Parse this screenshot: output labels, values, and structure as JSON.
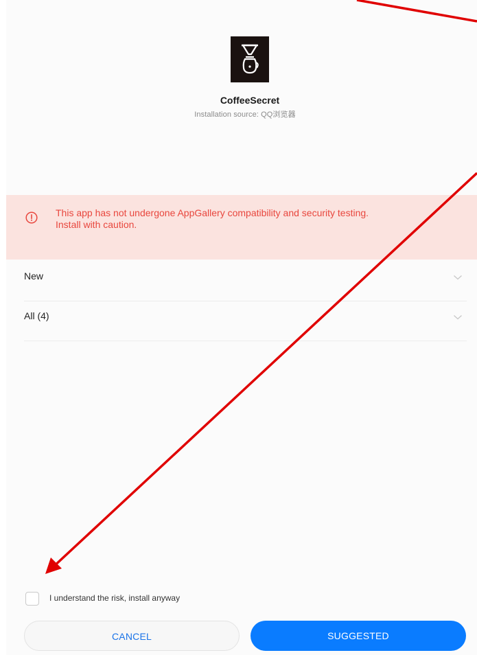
{
  "app": {
    "name": "CoffeeSecret",
    "install_source": "Installation source: QQ浏览器",
    "icon": "coffee-pour-over-icon"
  },
  "warning": {
    "icon": "alert-circle-icon",
    "text_line1": "This app has not undergone AppGallery compatibility and security testing.",
    "text_line2": "Install with caution.",
    "color": "#e8463d",
    "background": "#fbe3df"
  },
  "permissions": [
    {
      "label": "New",
      "icon": "chevron-down-icon"
    },
    {
      "label": "All (4)",
      "icon": "chevron-down-icon"
    }
  ],
  "consent": {
    "label": "I understand the risk, install anyway",
    "checked": false
  },
  "buttons": {
    "cancel": "CANCEL",
    "suggested": "SUGGESTED"
  },
  "colors": {
    "accent": "#0a7cff",
    "annotation_arrow": "#e00000"
  }
}
